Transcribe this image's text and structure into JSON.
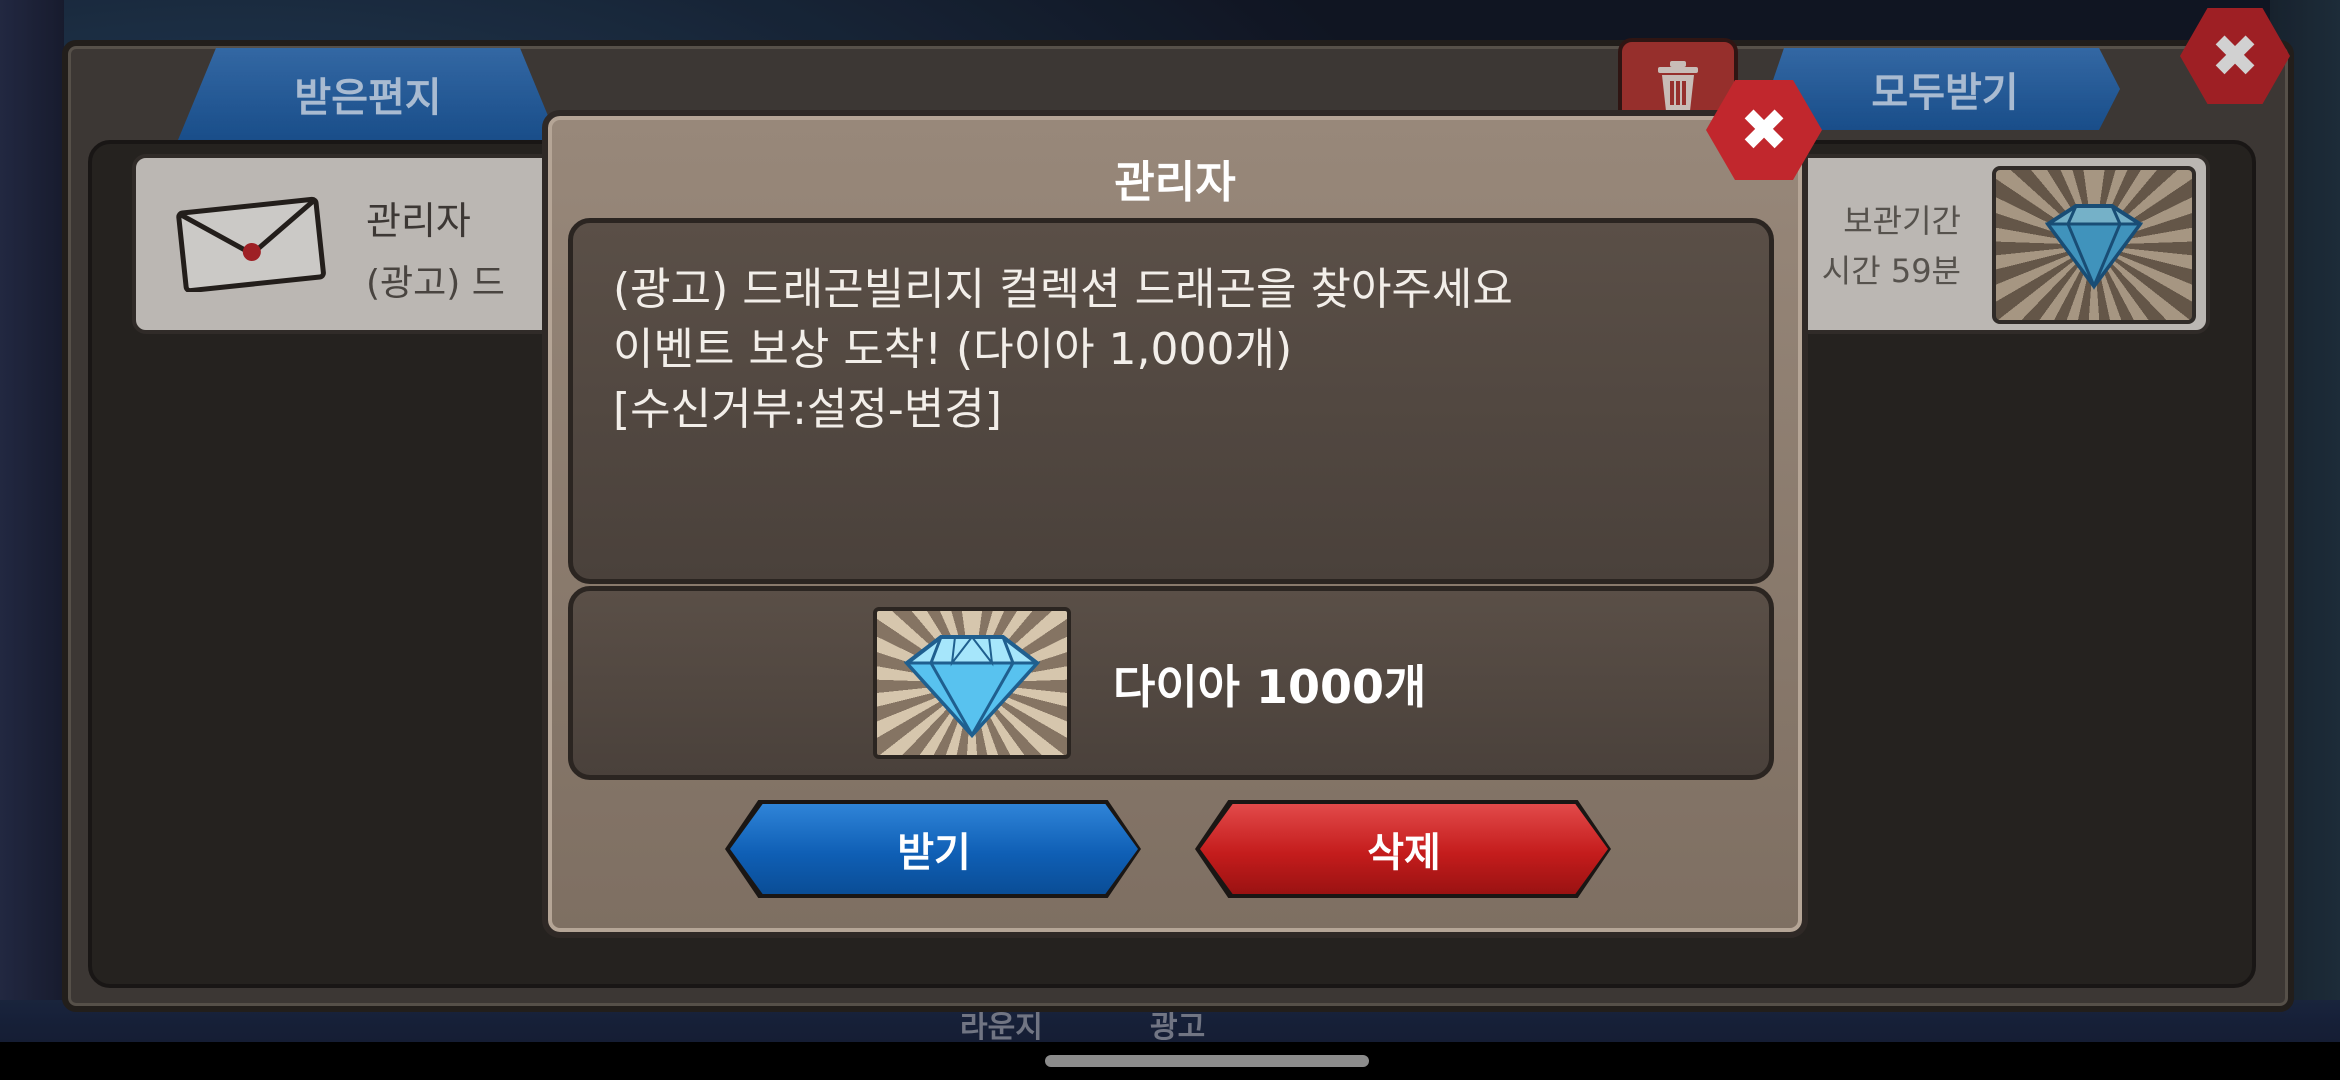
{
  "mailbox": {
    "tab_received": "받은편지",
    "receive_all": "모두받기",
    "row": {
      "sender": "관리자",
      "subject_preview": "(광고) 드",
      "keep_label": "보관기간",
      "time_left": "시간 59분"
    }
  },
  "background": {
    "bottom_labels": [
      "라운지",
      "광고"
    ]
  },
  "modal": {
    "title": "관리자",
    "message_lines": [
      "(광고) 드래곤빌리지 컬렉션 드래곤을 찾아주세요",
      "이벤트 보상 도착! (다이아 1,000개)",
      "[수신거부:설정-변경]"
    ],
    "reward": {
      "icon": "diamond-icon",
      "label": "다이아 1000개"
    },
    "accept_label": "받기",
    "delete_label": "삭제"
  },
  "colors": {
    "accept_blue": "#0f5fb5",
    "delete_red": "#c41c1c",
    "close_red": "#c1272d",
    "modal_brown": "#8a7a6c"
  }
}
